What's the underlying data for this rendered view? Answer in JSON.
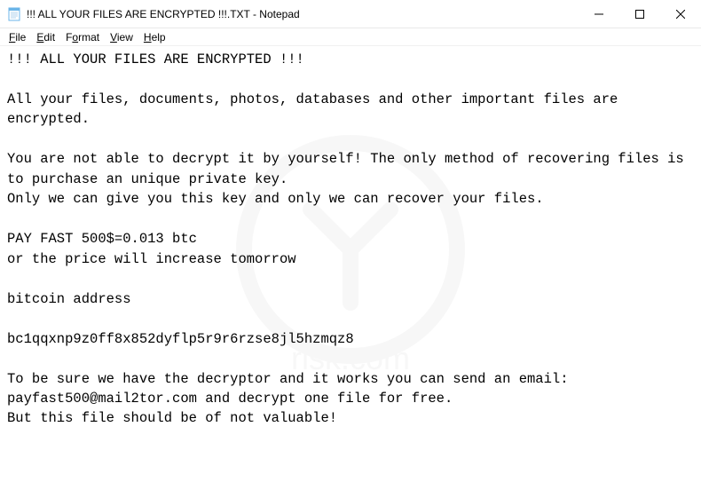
{
  "window": {
    "title": "!!! ALL YOUR FILES ARE ENCRYPTED !!!.TXT - Notepad"
  },
  "menu": {
    "file": "File",
    "edit": "Edit",
    "format": "Format",
    "view": "View",
    "help": "Help"
  },
  "body": {
    "line1": "!!! ALL YOUR FILES ARE ENCRYPTED !!!",
    "line2": "",
    "line3": "All your files, documents, photos, databases and other important files are encrypted.",
    "line4": "",
    "line5": "You are not able to decrypt it by yourself! The only method of recovering files is to purchase an unique private key.",
    "line6": "Only we can give you this key and only we can recover your files.",
    "line7": "",
    "line8": "PAY FAST 500$=0.013 btc",
    "line9": "or the price will increase tomorrow",
    "line10": "",
    "line11": "bitcoin address",
    "line12": "",
    "line13": "bc1qqxnp9z0ff8x852dyflp5r9r6rzse8jl5hzmqz8",
    "line14": "",
    "line15": "To be sure we have the decryptor and it works you can send an email: payfast500@mail2tor.com and decrypt one file for free.",
    "line16": "But this file should be of not valuable!"
  }
}
